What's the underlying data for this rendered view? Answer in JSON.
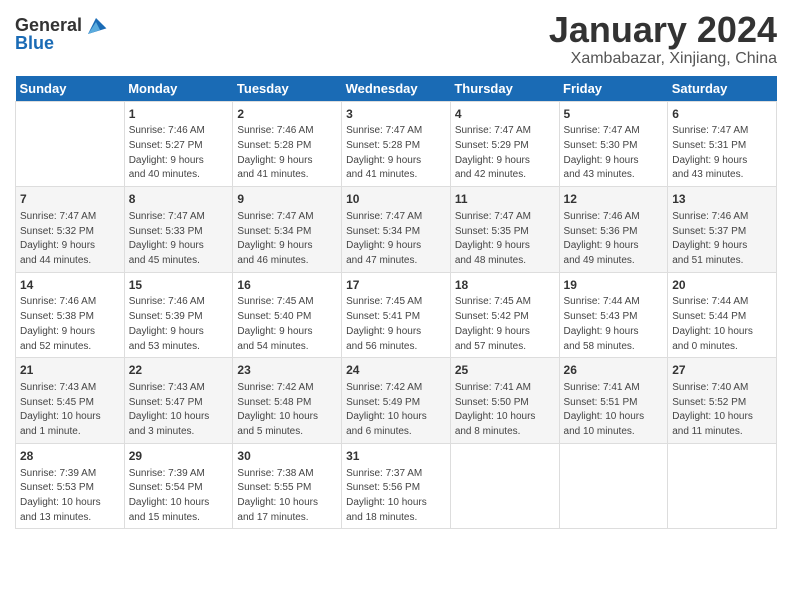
{
  "header": {
    "logo_line1": "General",
    "logo_line2": "Blue",
    "month": "January 2024",
    "location": "Xambabazar, Xinjiang, China"
  },
  "weekdays": [
    "Sunday",
    "Monday",
    "Tuesday",
    "Wednesday",
    "Thursday",
    "Friday",
    "Saturday"
  ],
  "weeks": [
    [
      {
        "day": "",
        "info": ""
      },
      {
        "day": "1",
        "info": "Sunrise: 7:46 AM\nSunset: 5:27 PM\nDaylight: 9 hours\nand 40 minutes."
      },
      {
        "day": "2",
        "info": "Sunrise: 7:46 AM\nSunset: 5:28 PM\nDaylight: 9 hours\nand 41 minutes."
      },
      {
        "day": "3",
        "info": "Sunrise: 7:47 AM\nSunset: 5:28 PM\nDaylight: 9 hours\nand 41 minutes."
      },
      {
        "day": "4",
        "info": "Sunrise: 7:47 AM\nSunset: 5:29 PM\nDaylight: 9 hours\nand 42 minutes."
      },
      {
        "day": "5",
        "info": "Sunrise: 7:47 AM\nSunset: 5:30 PM\nDaylight: 9 hours\nand 43 minutes."
      },
      {
        "day": "6",
        "info": "Sunrise: 7:47 AM\nSunset: 5:31 PM\nDaylight: 9 hours\nand 43 minutes."
      }
    ],
    [
      {
        "day": "7",
        "info": "Sunrise: 7:47 AM\nSunset: 5:32 PM\nDaylight: 9 hours\nand 44 minutes."
      },
      {
        "day": "8",
        "info": "Sunrise: 7:47 AM\nSunset: 5:33 PM\nDaylight: 9 hours\nand 45 minutes."
      },
      {
        "day": "9",
        "info": "Sunrise: 7:47 AM\nSunset: 5:34 PM\nDaylight: 9 hours\nand 46 minutes."
      },
      {
        "day": "10",
        "info": "Sunrise: 7:47 AM\nSunset: 5:34 PM\nDaylight: 9 hours\nand 47 minutes."
      },
      {
        "day": "11",
        "info": "Sunrise: 7:47 AM\nSunset: 5:35 PM\nDaylight: 9 hours\nand 48 minutes."
      },
      {
        "day": "12",
        "info": "Sunrise: 7:46 AM\nSunset: 5:36 PM\nDaylight: 9 hours\nand 49 minutes."
      },
      {
        "day": "13",
        "info": "Sunrise: 7:46 AM\nSunset: 5:37 PM\nDaylight: 9 hours\nand 51 minutes."
      }
    ],
    [
      {
        "day": "14",
        "info": "Sunrise: 7:46 AM\nSunset: 5:38 PM\nDaylight: 9 hours\nand 52 minutes."
      },
      {
        "day": "15",
        "info": "Sunrise: 7:46 AM\nSunset: 5:39 PM\nDaylight: 9 hours\nand 53 minutes."
      },
      {
        "day": "16",
        "info": "Sunrise: 7:45 AM\nSunset: 5:40 PM\nDaylight: 9 hours\nand 54 minutes."
      },
      {
        "day": "17",
        "info": "Sunrise: 7:45 AM\nSunset: 5:41 PM\nDaylight: 9 hours\nand 56 minutes."
      },
      {
        "day": "18",
        "info": "Sunrise: 7:45 AM\nSunset: 5:42 PM\nDaylight: 9 hours\nand 57 minutes."
      },
      {
        "day": "19",
        "info": "Sunrise: 7:44 AM\nSunset: 5:43 PM\nDaylight: 9 hours\nand 58 minutes."
      },
      {
        "day": "20",
        "info": "Sunrise: 7:44 AM\nSunset: 5:44 PM\nDaylight: 10 hours\nand 0 minutes."
      }
    ],
    [
      {
        "day": "21",
        "info": "Sunrise: 7:43 AM\nSunset: 5:45 PM\nDaylight: 10 hours\nand 1 minute."
      },
      {
        "day": "22",
        "info": "Sunrise: 7:43 AM\nSunset: 5:47 PM\nDaylight: 10 hours\nand 3 minutes."
      },
      {
        "day": "23",
        "info": "Sunrise: 7:42 AM\nSunset: 5:48 PM\nDaylight: 10 hours\nand 5 minutes."
      },
      {
        "day": "24",
        "info": "Sunrise: 7:42 AM\nSunset: 5:49 PM\nDaylight: 10 hours\nand 6 minutes."
      },
      {
        "day": "25",
        "info": "Sunrise: 7:41 AM\nSunset: 5:50 PM\nDaylight: 10 hours\nand 8 minutes."
      },
      {
        "day": "26",
        "info": "Sunrise: 7:41 AM\nSunset: 5:51 PM\nDaylight: 10 hours\nand 10 minutes."
      },
      {
        "day": "27",
        "info": "Sunrise: 7:40 AM\nSunset: 5:52 PM\nDaylight: 10 hours\nand 11 minutes."
      }
    ],
    [
      {
        "day": "28",
        "info": "Sunrise: 7:39 AM\nSunset: 5:53 PM\nDaylight: 10 hours\nand 13 minutes."
      },
      {
        "day": "29",
        "info": "Sunrise: 7:39 AM\nSunset: 5:54 PM\nDaylight: 10 hours\nand 15 minutes."
      },
      {
        "day": "30",
        "info": "Sunrise: 7:38 AM\nSunset: 5:55 PM\nDaylight: 10 hours\nand 17 minutes."
      },
      {
        "day": "31",
        "info": "Sunrise: 7:37 AM\nSunset: 5:56 PM\nDaylight: 10 hours\nand 18 minutes."
      },
      {
        "day": "",
        "info": ""
      },
      {
        "day": "",
        "info": ""
      },
      {
        "day": "",
        "info": ""
      }
    ]
  ]
}
